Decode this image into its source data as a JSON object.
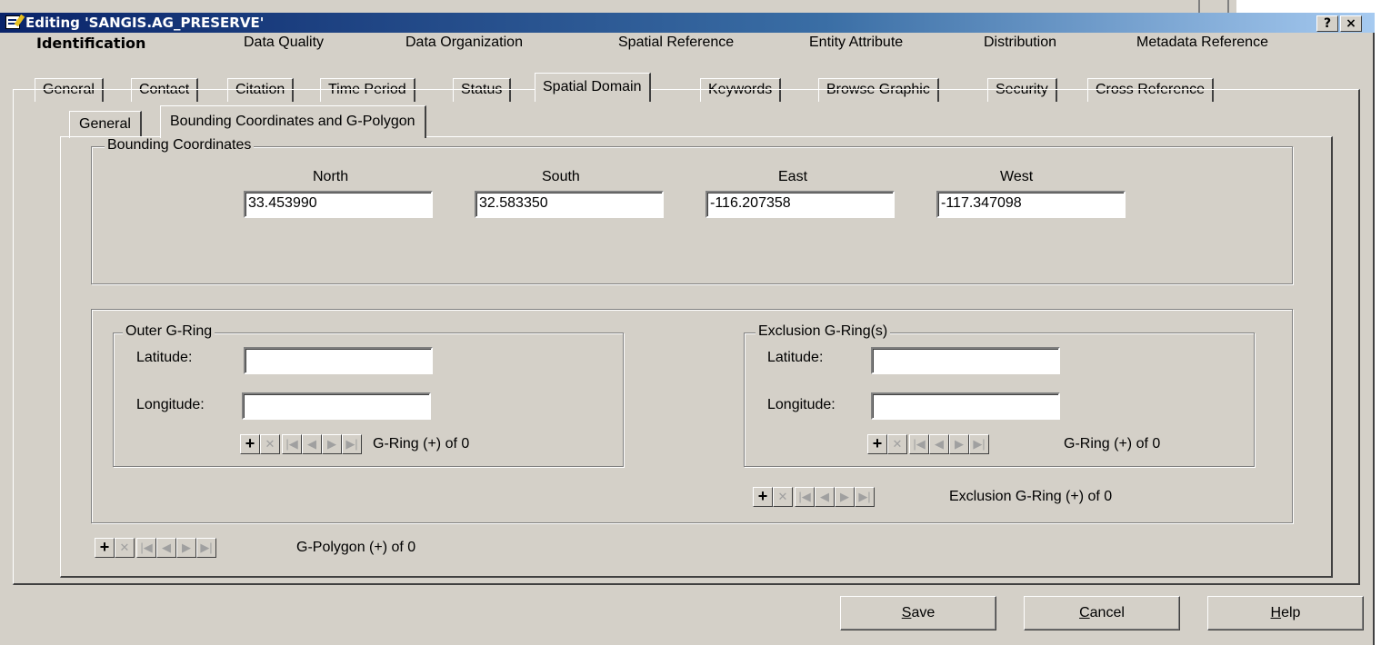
{
  "window": {
    "title": "Editing 'SANGIS.AG_PRESERVE'",
    "help_button": "?",
    "close_button": "×"
  },
  "top_tabs": [
    "Identification",
    "Data Quality",
    "Data Organization",
    "Spatial Reference",
    "Entity Attribute",
    "Distribution",
    "Metadata Reference"
  ],
  "sub_tabs": [
    "General",
    "Contact",
    "Citation",
    "Time Period",
    "Status",
    "Spatial Domain",
    "Keywords",
    "Browse Graphic",
    "Security",
    "Cross Reference"
  ],
  "inner_tabs": [
    "General",
    "Bounding Coordinates and G-Polygon"
  ],
  "bounding": {
    "legend": "Bounding Coordinates",
    "north_label": "North",
    "north_value": "33.453990",
    "south_label": "South",
    "south_value": "32.583350",
    "east_label": "East",
    "east_value": "-116.207358",
    "west_label": "West",
    "west_value": "-117.347098"
  },
  "outer_ring": {
    "legend": "Outer G-Ring",
    "latitude_label": "Latitude:",
    "latitude_value": "",
    "longitude_label": "Longitude:",
    "longitude_value": "",
    "nav_text": "G-Ring (+) of 0"
  },
  "exclusion_ring": {
    "legend": "Exclusion G-Ring(s)",
    "latitude_label": "Latitude:",
    "latitude_value": "",
    "longitude_label": "Longitude:",
    "longitude_value": "",
    "nav_text": "G-Ring (+) of 0",
    "outer_nav_text": "Exclusion G-Ring (+) of 0"
  },
  "polygon_nav_text": "G-Polygon (+) of 0",
  "nav_icons": {
    "add": "+",
    "delete": "✕",
    "first": "|◀",
    "prev": "◀",
    "next": "▶",
    "last": "▶|"
  },
  "buttons": {
    "save_first": "S",
    "save_rest": "ave",
    "cancel_first": "C",
    "cancel_rest": "ancel",
    "help_first": "H",
    "help_rest": "elp"
  }
}
